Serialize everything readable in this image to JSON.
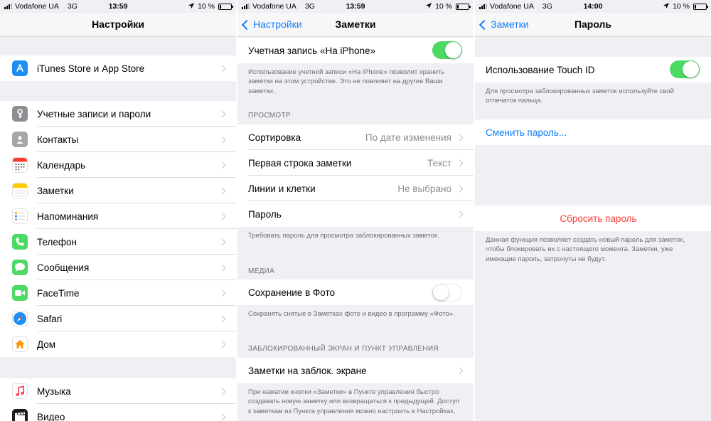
{
  "colors": {
    "accent": "#147efb",
    "toggle_on": "#4cd964",
    "destructive": "#ff3b30",
    "background": "#efeff4"
  },
  "panel1": {
    "status": {
      "carrier": "Vodafone UA",
      "network": "3G",
      "time": "13:59",
      "battery": "10 %"
    },
    "title": "Настройки",
    "group1": [
      {
        "label": "iTunes Store и App Store",
        "icon": "app-store-icon"
      }
    ],
    "group2": [
      {
        "label": "Учетные записи и пароли",
        "icon": "key-icon"
      },
      {
        "label": "Контакты",
        "icon": "contacts-icon"
      },
      {
        "label": "Календарь",
        "icon": "calendar-icon"
      },
      {
        "label": "Заметки",
        "icon": "notes-icon"
      },
      {
        "label": "Напоминания",
        "icon": "reminders-icon"
      },
      {
        "label": "Телефон",
        "icon": "phone-icon"
      },
      {
        "label": "Сообщения",
        "icon": "messages-icon"
      },
      {
        "label": "FaceTime",
        "icon": "facetime-icon"
      },
      {
        "label": "Safari",
        "icon": "safari-icon"
      },
      {
        "label": "Дом",
        "icon": "home-icon"
      }
    ],
    "group3": [
      {
        "label": "Музыка",
        "icon": "music-icon"
      },
      {
        "label": "Видео",
        "icon": "video-icon"
      }
    ]
  },
  "panel2": {
    "status": {
      "carrier": "Vodafone UA",
      "network": "3G",
      "time": "13:59",
      "battery": "10 %"
    },
    "back": "Настройки",
    "title": "Заметки",
    "account_row": {
      "label": "Учетная запись «На iPhone»",
      "toggle": "on"
    },
    "account_note": "Использование учетной записи «На iPhone» позволит хранить заметки на этом устройстве. Это не повлияет на другие Ваши заметки.",
    "view_header": "ПРОСМОТР",
    "view_rows": [
      {
        "label": "Сортировка",
        "value": "По дате изменения"
      },
      {
        "label": "Первая строка заметки",
        "value": "Текст"
      },
      {
        "label": "Линии и клетки",
        "value": "Не выбрано"
      },
      {
        "label": "Пароль",
        "value": ""
      }
    ],
    "password_note": "Требовать пароль для просмотра заблокированных заметок.",
    "media_header": "МЕДИА",
    "media_row": {
      "label": "Сохранение в Фото",
      "toggle": "off"
    },
    "media_note": "Сохранять снятые в Заметках фото и видео в программу «Фото».",
    "lock_header": "ЗАБЛОКИРОВАННЫЙ ЭКРАН И ПУНКТ УПРАВЛЕНИЯ",
    "lock_row": {
      "label": "Заметки на заблок. экране"
    },
    "lock_note": "При нажатии кнопки «Заметки» в Пункте управления быстро создавать новую заметку или возвращаться к предыдущей. Доступ к заметкам из Пункта управления можно настроить в Настройках."
  },
  "panel3": {
    "status": {
      "carrier": "Vodafone UA",
      "network": "3G",
      "time": "14:00",
      "battery": "10 %"
    },
    "back": "Заметки",
    "title": "Пароль",
    "touchid_row": {
      "label": "Использование Touch ID",
      "toggle": "on"
    },
    "touchid_note": "Для просмотра заблокированных заметок используйте свой отпечаток пальца.",
    "change_password": "Сменить пароль...",
    "reset_password": "Сбросить пароль",
    "reset_note": "Данная функция позволяет создать новый пароль для заметок, чтобы блокировать их с настоящего момента. Заметки, уже имеющие пароль, затронуты не будут."
  }
}
